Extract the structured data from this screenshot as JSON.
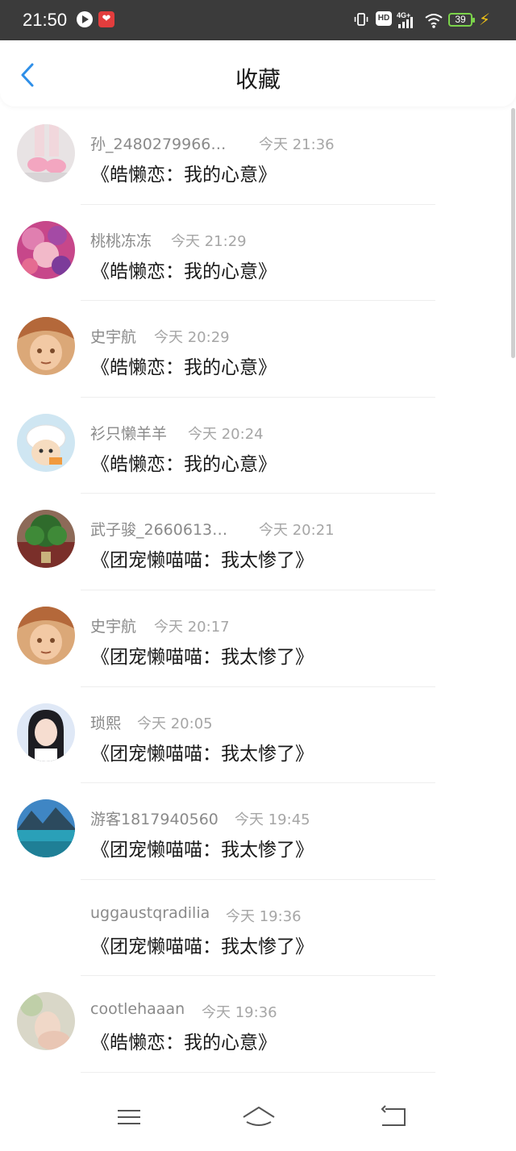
{
  "status_bar": {
    "time": "21:50",
    "hd_label": "HD",
    "network": "4G",
    "battery": "39"
  },
  "header": {
    "title": "收藏"
  },
  "items": [
    {
      "user": "孙_2480279966…",
      "time": "今天 21:36",
      "title": "《皓懒恋：我的心意》"
    },
    {
      "user": "桃桃冻冻",
      "time": "今天 21:29",
      "title": "《皓懒恋：我的心意》"
    },
    {
      "user": "史宇航",
      "time": "今天 20:29",
      "title": "《皓懒恋：我的心意》"
    },
    {
      "user": "衫只懒羊羊",
      "time": "今天 20:24",
      "title": "《皓懒恋：我的心意》"
    },
    {
      "user": "武子骏_2660613…",
      "time": "今天 20:21",
      "title": "《团宠懒喵喵：我太惨了》"
    },
    {
      "user": "史宇航",
      "time": "今天 20:17",
      "title": "《团宠懒喵喵：我太惨了》"
    },
    {
      "user": "琐熙",
      "time": "今天 20:05",
      "title": "《团宠懒喵喵：我太惨了》"
    },
    {
      "user": "游客1817940560",
      "time": "今天 19:45",
      "title": "《团宠懒喵喵：我太惨了》"
    },
    {
      "user": "uggaustqradilia",
      "time": "今天 19:36",
      "title": "《团宠懒喵喵：我太惨了》"
    },
    {
      "user": "cootlehaaan",
      "time": "今天 19:36",
      "title": "《皓懒恋：我的心意》"
    }
  ]
}
